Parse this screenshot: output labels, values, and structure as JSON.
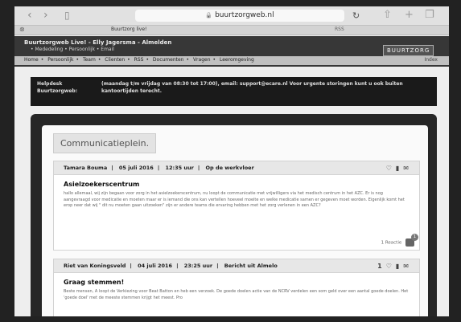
{
  "browser": {
    "url": "buurtzorgweb.nl",
    "tab_title": "Buurtzorg live!",
    "tab_right_label": "RSS"
  },
  "site": {
    "title": "Buurtzorgweb Live! - Elly Jagersma - Almelden",
    "links": "• Mededeling • Persoonlijk • Email",
    "logo": "BUURTZORG",
    "nav_items": [
      "Home",
      "Persoonlijk",
      "Team",
      "Clienten",
      "RSS",
      "Documenten",
      "Vragen",
      "Leeromgeving"
    ],
    "nav_right": "Index"
  },
  "helpdesk": {
    "label": "Helpdesk Buurtzorgweb:",
    "text": "(maandag t/m vrijdag van 08:30 tot 17:00), email: support@ecare.nl Voor urgente storingen kunt u ook buiten kantoortijden terecht."
  },
  "page_title": "Communicatieplein.",
  "posts": [
    {
      "author": "Tamara Bouma",
      "date": "05 juli 2016",
      "time": "12:35 uur",
      "category": "Op de werkvloer",
      "title": "Asielzoekerscentrum",
      "body": "hallo allemaal, wij zijn begaan voor zorg in het asielzoekerscentrum, nu loopt de communicatie met vrijwilligers via het medisch centrum in het AZC. Er is nog aangevraagd voor medicatie en moeten maar er is iemand die ons kan vertellen hoeveel moeite en welke medicatie samen er gegeven moet worden. Eigenlijk komt het erop neer dat wij \" dit nu moeten gaan uitzoeken\" zijn er andere teams die ervaring hebben met het zorg verlenen in een AZC?",
      "reactions_label": "1 Reactie",
      "reactions_count": "1"
    },
    {
      "author": "Riet van Koningsveld",
      "date": "04 juli 2016",
      "time": "23:25 uur",
      "category": "Bericht uit Almelo",
      "title": "Graag stemmen!",
      "body": "Beste mensen, A loopt de Verkiezing voor Beat Batton en heb een verzoek. De goede doelen actie van de NCRV verdelen een som geld over een aantal goede doelen. Het 'goede doel' met de meeste stemmen krijgt het meest. Pro",
      "likes": "1"
    }
  ]
}
